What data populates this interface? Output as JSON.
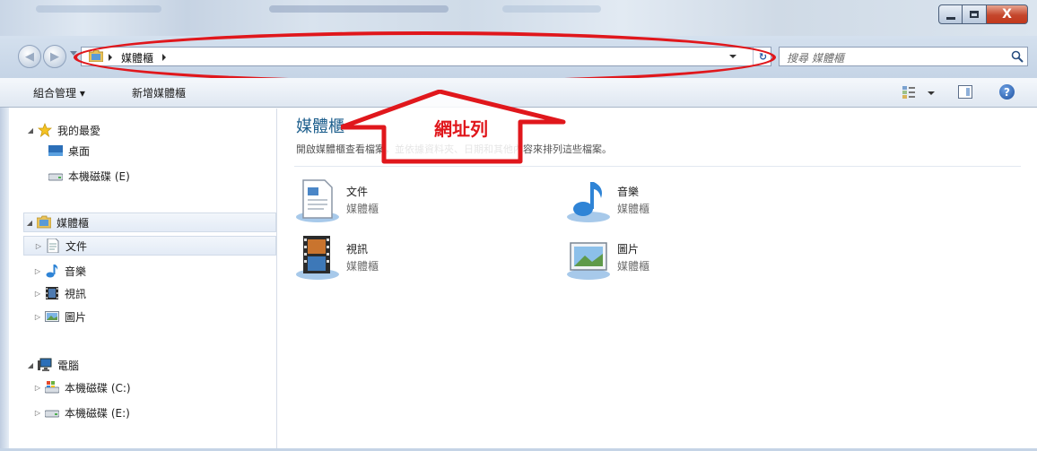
{
  "window": {
    "minimize_label": "—",
    "maximize_label": "▢",
    "close_label": "X"
  },
  "address": {
    "breadcrumb": "媒體櫃",
    "search_placeholder": "搜尋 媒體櫃"
  },
  "annotation": {
    "label": "網址列",
    "color": "#e0171c"
  },
  "toolbar": {
    "organize_label": "組合管理 ▾",
    "new_library_label": "新增媒體櫃"
  },
  "sidebar": {
    "favorites": {
      "label": "我的最愛",
      "items": [
        {
          "label": "桌面",
          "icon": "desktop-icon"
        },
        {
          "label": "本機磁碟 (E)",
          "icon": "drive-icon"
        }
      ]
    },
    "libraries": {
      "label": "媒體櫃",
      "items": [
        {
          "label": "文件",
          "icon": "document-icon"
        },
        {
          "label": "音樂",
          "icon": "music-icon"
        },
        {
          "label": "視訊",
          "icon": "video-icon"
        },
        {
          "label": "圖片",
          "icon": "picture-icon"
        }
      ]
    },
    "computer": {
      "label": "電腦",
      "items": [
        {
          "label": "本機磁碟 (C:)",
          "icon": "system-drive-icon"
        },
        {
          "label": "本機磁碟 (E:)",
          "icon": "drive-icon"
        }
      ]
    }
  },
  "content": {
    "title": "媒體櫃",
    "description": "開啟媒體櫃查看檔案，並依據資料夾、日期和其他內容來排列這些檔案。",
    "tiles": [
      {
        "name": "文件",
        "subtitle": "媒體櫃",
        "icon": "document-library-icon"
      },
      {
        "name": "音樂",
        "subtitle": "媒體櫃",
        "icon": "music-library-icon"
      },
      {
        "name": "視訊",
        "subtitle": "媒體櫃",
        "icon": "video-library-icon"
      },
      {
        "name": "圖片",
        "subtitle": "媒體櫃",
        "icon": "picture-library-icon"
      }
    ]
  },
  "colors": {
    "title_blue": "#1c5e8c",
    "annotation_red": "#e0171c",
    "chrome_blue": "#c5d4e6"
  }
}
